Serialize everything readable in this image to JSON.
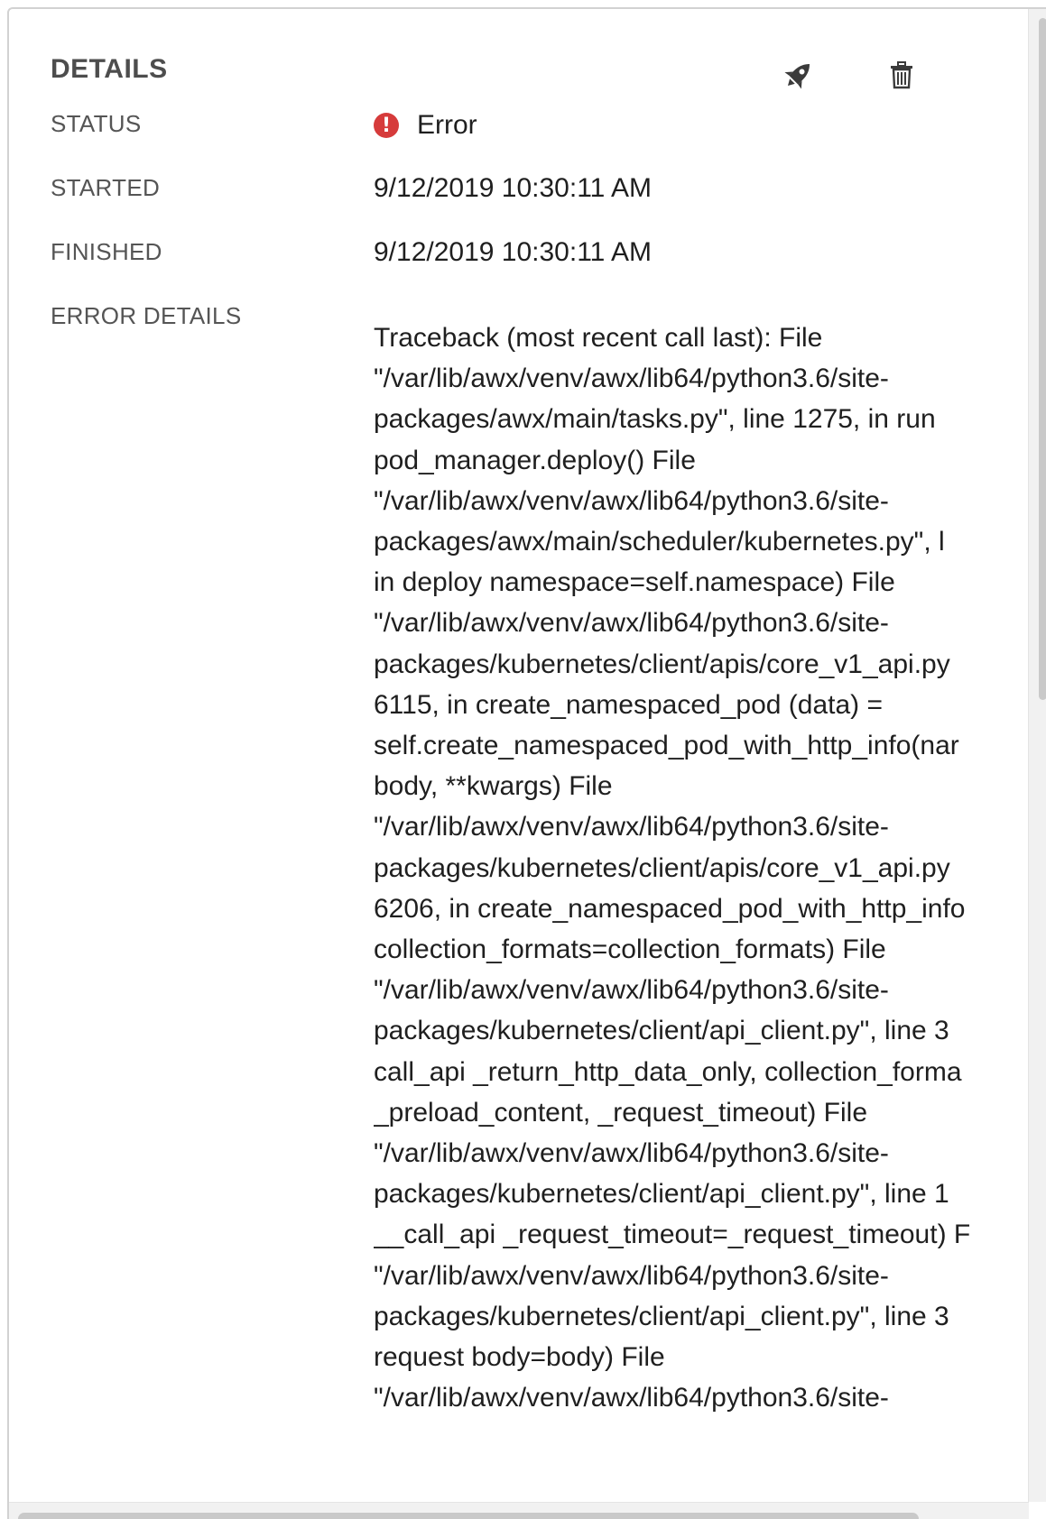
{
  "details": {
    "title": "DETAILS",
    "actions": {
      "launch_icon": "rocket-icon",
      "delete_icon": "trash-icon"
    },
    "status": {
      "label": "STATUS",
      "value": "Error",
      "icon": "exclamation-circle-icon",
      "color": "#d63b3b"
    },
    "started": {
      "label": "STARTED",
      "value": "9/12/2019 10:30:11 AM"
    },
    "finished": {
      "label": "FINISHED",
      "value": "9/12/2019 10:30:11 AM"
    },
    "error_details": {
      "label": "ERROR DETAILS",
      "lines": [
        "Traceback (most recent call last): File",
        "\"/var/lib/awx/venv/awx/lib64/python3.6/site-",
        "packages/awx/main/tasks.py\", line 1275, in run",
        "pod_manager.deploy() File",
        "\"/var/lib/awx/venv/awx/lib64/python3.6/site-",
        "packages/awx/main/scheduler/kubernetes.py\", l",
        "in deploy namespace=self.namespace) File",
        "\"/var/lib/awx/venv/awx/lib64/python3.6/site-",
        "packages/kubernetes/client/apis/core_v1_api.py",
        "6115, in create_namespaced_pod (data) =",
        "self.create_namespaced_pod_with_http_info(nar",
        "body, **kwargs) File",
        "\"/var/lib/awx/venv/awx/lib64/python3.6/site-",
        "packages/kubernetes/client/apis/core_v1_api.py",
        "6206, in create_namespaced_pod_with_http_info",
        "collection_formats=collection_formats) File",
        "\"/var/lib/awx/venv/awx/lib64/python3.6/site-",
        "packages/kubernetes/client/api_client.py\", line 3",
        "call_api _return_http_data_only, collection_forma",
        "_preload_content, _request_timeout) File",
        "\"/var/lib/awx/venv/awx/lib64/python3.6/site-",
        "packages/kubernetes/client/api_client.py\", line 1",
        "__call_api _request_timeout=_request_timeout) F",
        "\"/var/lib/awx/venv/awx/lib64/python3.6/site-",
        "packages/kubernetes/client/api_client.py\", line 3",
        "request body=body) File",
        "\"/var/lib/awx/venv/awx/lib64/python3.6/site-"
      ]
    }
  }
}
